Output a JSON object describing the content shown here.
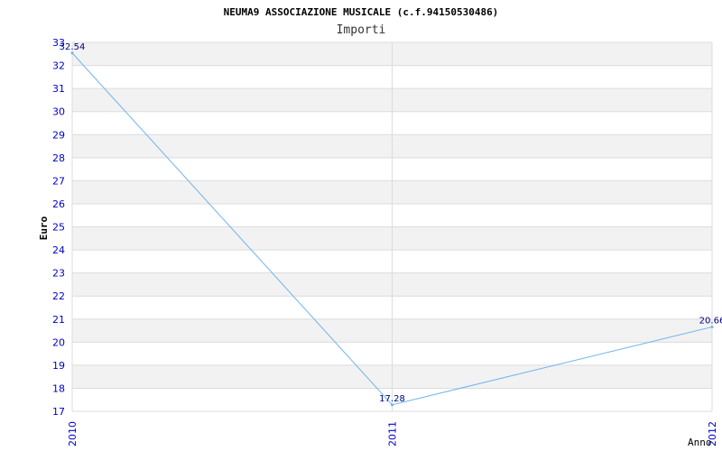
{
  "chart_data": {
    "type": "line",
    "title": "NEUMA9 ASSOCIAZIONE MUSICALE (c.f.94150530486)",
    "subtitle": "Importi",
    "xlabel": "Anno",
    "ylabel": "Euro",
    "categories": [
      "2010",
      "2011",
      "2012"
    ],
    "series": [
      {
        "values": [
          32.54,
          17.28,
          20.66
        ],
        "labels": [
          "32.54",
          "17.28",
          "20.66"
        ]
      }
    ],
    "ylim": [
      17,
      33
    ],
    "yticks": [
      "17",
      "18",
      "19",
      "20",
      "21",
      "22",
      "23",
      "24",
      "25",
      "26",
      "27",
      "28",
      "29",
      "30",
      "31",
      "32",
      "33"
    ],
    "grid": true,
    "colors": {
      "line": "#6eb4f0",
      "band": "#f2f2f2",
      "grid": "#dcdcdc",
      "tick_text": "#0000cc",
      "label_text": "#000080",
      "title_text": "#000000"
    }
  }
}
